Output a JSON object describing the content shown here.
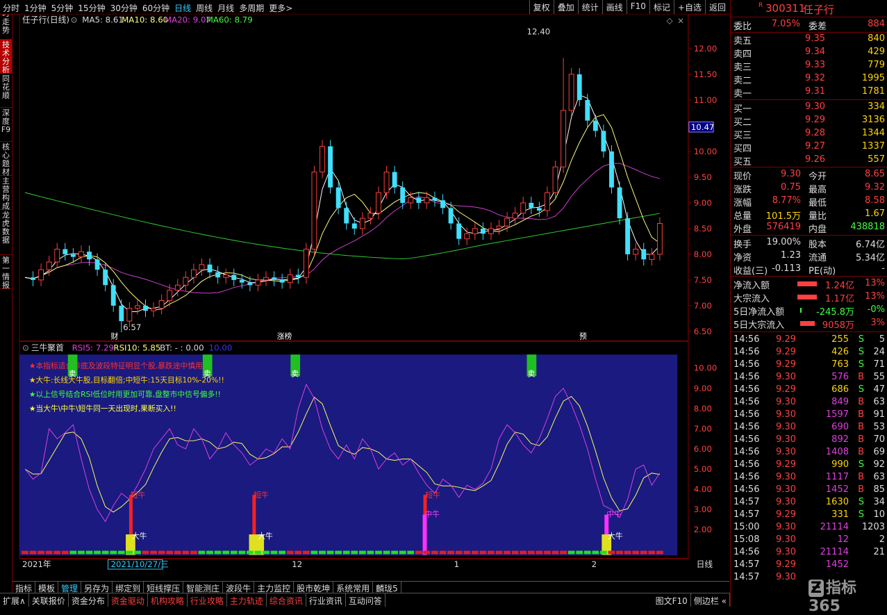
{
  "toolbar": {
    "periods": [
      "分时",
      "1分钟",
      "5分钟",
      "15分钟",
      "30分钟",
      "60分钟",
      "日线",
      "周线",
      "月线",
      "多周期",
      "更多>"
    ],
    "active_period": 6,
    "tools": [
      "复权",
      "叠加",
      "统计",
      "画线",
      "F10",
      "标记",
      "+自选",
      "返回"
    ]
  },
  "vtabs": [
    {
      "label": "分时走势",
      "active": false
    },
    {
      "label": "技术分析",
      "active": true
    },
    {
      "label": "同花顺",
      "active": false
    },
    {
      "label": "深度F9",
      "active": false
    },
    {
      "label": "核心题材",
      "active": false
    },
    {
      "label": "主营构成",
      "active": false
    },
    {
      "label": "龙虎数据",
      "active": false
    },
    {
      "label": "第一情报",
      "active": false
    }
  ],
  "main_legend": {
    "title": "任子行(日线)",
    "ma5": "MA5: 8.61",
    "ma10": "MA10: 8.60",
    "ma20": "MA20: 9.07",
    "ma60": "MA60: 8.79"
  },
  "price_axis": [
    "12.00",
    "11.50",
    "11.00",
    "10.47",
    "10.00",
    "9.50",
    "9.00",
    "8.50",
    "8.00",
    "7.50",
    "7.00",
    "6.50"
  ],
  "price_annotations": {
    "high": "12.40",
    "low": "6.57",
    "current_box": "10.47"
  },
  "event_markers": [
    "财",
    "涨榜",
    "预"
  ],
  "ind_legend": {
    "title": "三牛聚首",
    "rsi5": "RSI5: 7.29",
    "rsi10": "RSI10: 5.85",
    "bt": "BT: - : 0.00",
    "extra": "10.00"
  },
  "ind_axis": [
    "10.00",
    "9.00",
    "8.00",
    "7.00",
    "6.00",
    "5.00",
    "4.00",
    "3.00",
    "2.00"
  ],
  "ind_notes": [
    {
      "text": "★本指标适合抄底及波段特征明显个股,暴跌途中慎用!!",
      "color": "#ff3030"
    },
    {
      "text": "★大牛:长线大牛股,目标翻倍;中短牛:15天目标10%-20%!!",
      "color": "#ffd700"
    },
    {
      "text": "★以上信号结合RSI低位时用更加可靠,盘整市中信号偏多!!",
      "color": "#40ff40"
    },
    {
      "text": "★当大牛\\中牛\\短牛同一天出现时,果断买入!!",
      "color": "#ffff40"
    }
  ],
  "ind_signals": {
    "sell": "卖",
    "short": "短牛",
    "mid": "中牛",
    "big": "大牛"
  },
  "date_axis": {
    "year": "2021年",
    "cursor": "2021/10/27/三",
    "m12": "12",
    "m1": "1",
    "m2": "2",
    "right": "日线"
  },
  "bottom_tabs": [
    "指标",
    "模板",
    "管理",
    "另存为",
    "绑定到",
    "短线撑压",
    "智能测庄",
    "波段牛",
    "主力监控",
    "股市乾坤",
    "系统常用",
    "麟珑5"
  ],
  "bottom_active": 2,
  "status_tabs": [
    "扩展∧",
    "关联报价",
    "资金分布",
    "资金驱动",
    "机构攻略",
    "行业攻略",
    "主力轨迹",
    "综合资讯",
    "行业资讯",
    "互动问答"
  ],
  "status_highlight": [
    3,
    4,
    5,
    6,
    7
  ],
  "status_right": [
    "图文F10",
    "侧边栏 «"
  ],
  "quote": {
    "code": "300311",
    "name": "任子行",
    "badge": "R",
    "weibi_label": "委比",
    "weibi": "7.05%",
    "weicha_label": "委差",
    "weicha": "884",
    "asks": [
      {
        "label": "卖五",
        "price": "9.35",
        "vol": "840"
      },
      {
        "label": "卖四",
        "price": "9.34",
        "vol": "429"
      },
      {
        "label": "卖三",
        "price": "9.33",
        "vol": "779"
      },
      {
        "label": "卖二",
        "price": "9.32",
        "vol": "1995"
      },
      {
        "label": "卖一",
        "price": "9.31",
        "vol": "1781"
      }
    ],
    "bids": [
      {
        "label": "买一",
        "price": "9.30",
        "vol": "334"
      },
      {
        "label": "买二",
        "price": "9.29",
        "vol": "3136"
      },
      {
        "label": "买三",
        "price": "9.28",
        "vol": "1344"
      },
      {
        "label": "买四",
        "price": "9.27",
        "vol": "1337"
      },
      {
        "label": "买五",
        "price": "9.26",
        "vol": "557"
      }
    ],
    "stats": [
      {
        "l1": "现价",
        "v1": "9.30",
        "l2": "今开",
        "v2": "8.65",
        "c1": "red",
        "c2": "red"
      },
      {
        "l1": "涨跌",
        "v1": "0.75",
        "l2": "最高",
        "v2": "9.32",
        "c1": "red",
        "c2": "red"
      },
      {
        "l1": "涨幅",
        "v1": "8.77%",
        "l2": "最低",
        "v2": "8.58",
        "c1": "red",
        "c2": "red"
      },
      {
        "l1": "总量",
        "v1": "101.5万",
        "l2": "量比",
        "v2": "1.67",
        "c1": "yellow",
        "c2": "yellow"
      },
      {
        "l1": "外盘",
        "v1": "576419",
        "l2": "内盘",
        "v2": "438818",
        "c1": "red",
        "c2": "green"
      },
      {
        "l1": "换手",
        "v1": "19.00%",
        "l2": "股本",
        "v2": "6.74亿",
        "c1": "white",
        "c2": "white"
      },
      {
        "l1": "净资",
        "v1": "1.23",
        "l2": "流通",
        "v2": "5.34亿",
        "c1": "white",
        "c2": "white"
      },
      {
        "l1": "收益(三)",
        "v1": "-0.113",
        "l2": "PE(动)",
        "v2": "-",
        "c1": "white",
        "c2": "white"
      }
    ],
    "flows": [
      {
        "label": "净流入额",
        "value": "1.24亿",
        "pct": "13%",
        "bar": 0.4,
        "color": "red"
      },
      {
        "label": "大宗流入",
        "value": "1.17亿",
        "pct": "13%",
        "bar": 0.4,
        "color": "red"
      },
      {
        "label": "5日净流入额",
        "value": "-245.8万",
        "pct": "-0%",
        "bar": 0.02,
        "color": "green"
      },
      {
        "label": "5日大宗流入",
        "value": "9058万",
        "pct": "3%",
        "bar": 0.3,
        "color": "red"
      }
    ],
    "ticks": [
      {
        "t": "14:56",
        "p": "9.29",
        "v": "255",
        "s": "S",
        "n": "5"
      },
      {
        "t": "14:56",
        "p": "9.29",
        "v": "426",
        "s": "S",
        "n": "24"
      },
      {
        "t": "14:56",
        "p": "9.29",
        "v": "763",
        "s": "S",
        "n": "71"
      },
      {
        "t": "14:56",
        "p": "9.30",
        "v": "576",
        "s": "B",
        "n": "55"
      },
      {
        "t": "14:56",
        "p": "9.29",
        "v": "686",
        "s": "S",
        "n": "47"
      },
      {
        "t": "14:56",
        "p": "9.30",
        "v": "849",
        "s": "B",
        "n": "63"
      },
      {
        "t": "14:56",
        "p": "9.30",
        "v": "1597",
        "s": "B",
        "n": "91"
      },
      {
        "t": "14:56",
        "p": "9.30",
        "v": "690",
        "s": "B",
        "n": "53"
      },
      {
        "t": "14:56",
        "p": "9.30",
        "v": "892",
        "s": "B",
        "n": "70"
      },
      {
        "t": "14:56",
        "p": "9.30",
        "v": "1408",
        "s": "B",
        "n": "69"
      },
      {
        "t": "14:56",
        "p": "9.29",
        "v": "990",
        "s": "S",
        "n": "92"
      },
      {
        "t": "14:56",
        "p": "9.30",
        "v": "1117",
        "s": "B",
        "n": "63"
      },
      {
        "t": "14:56",
        "p": "9.30",
        "v": "1452",
        "s": "B",
        "n": "85"
      },
      {
        "t": "14:57",
        "p": "9.30",
        "v": "1630",
        "s": "S",
        "n": "34"
      },
      {
        "t": "14:57",
        "p": "9.29",
        "v": "331",
        "s": "S",
        "n": "10"
      },
      {
        "t": "15:00",
        "p": "9.30",
        "v": "21114",
        "s": "",
        "n": "1203"
      },
      {
        "t": "15:08",
        "p": "9.30",
        "v": "12",
        "s": "",
        "n": "2"
      },
      {
        "t": "14:56",
        "p": "9.30",
        "v": "21114",
        "s": "",
        "n": "21"
      },
      {
        "t": "14:57",
        "p": "9.29",
        "v": "1452",
        "s": "",
        "n": ""
      },
      {
        "t": "14:57",
        "p": "9.30",
        "v": "",
        "s": "",
        "n": ""
      }
    ],
    "watermark": "指标365"
  }
}
